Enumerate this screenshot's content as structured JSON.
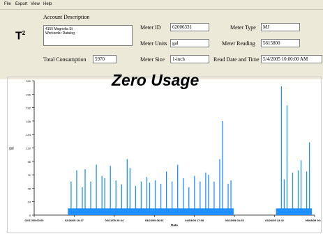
{
  "menu": [
    "File",
    "Export",
    "View",
    "Help"
  ],
  "logo": {
    "text": "T",
    "sup": "2"
  },
  "account": {
    "label": "Account Description",
    "line1": "4155 Magnolia St",
    "line2": "Workorder Datalog"
  },
  "fields": {
    "meter_id_label": "Meter ID",
    "meter_id": "62006331",
    "meter_type_label": "Meter Type",
    "meter_type": "MJ",
    "meter_units_label": "Meter Units",
    "meter_units": "gal",
    "meter_reading_label": "Meter Reading",
    "meter_reading": "5615800",
    "total_consumption_label": "Total Consumption",
    "total_consumption": "5970",
    "meter_size_label": "Meter Size",
    "meter_size": "1-inch",
    "read_date_label": "Read Date and Time",
    "read_date": "5/4/2005 10:00:00 AM"
  },
  "overlay_text": "Zero Usage",
  "chart_data": {
    "type": "bar",
    "xlabel": "Date",
    "ylabel": "gal",
    "ylim": [
      0,
      240
    ],
    "yticks": [
      0,
      24,
      48,
      72,
      96,
      120,
      144,
      168,
      192,
      216,
      240
    ],
    "xlim": [
      "02/17/05 00:00",
      "05/08/05 00:00"
    ],
    "xticks": [
      "02/17/05 00:00",
      "02/26/05 10:17",
      "03/11/05 20:34",
      "03/23/05 06:51",
      "04/03/05 17:08",
      "04/15/05 03:25",
      "04/26/05 13:42",
      "05/08/05 00:00"
    ],
    "bar_color": "#1e90ff",
    "baseline_band_gal": 12,
    "gap_label": "Zero Usage",
    "gap_range": [
      "04/15/05 03:25",
      "04/26/05 13:42"
    ],
    "spikes_gal": [
      [
        0.13,
        60
      ],
      [
        0.15,
        80
      ],
      [
        0.17,
        50
      ],
      [
        0.18,
        82
      ],
      [
        0.2,
        60
      ],
      [
        0.22,
        90
      ],
      [
        0.24,
        70
      ],
      [
        0.25,
        66
      ],
      [
        0.27,
        88
      ],
      [
        0.29,
        62
      ],
      [
        0.31,
        55
      ],
      [
        0.33,
        100
      ],
      [
        0.34,
        84
      ],
      [
        0.36,
        52
      ],
      [
        0.38,
        60
      ],
      [
        0.4,
        68
      ],
      [
        0.41,
        58
      ],
      [
        0.43,
        62
      ],
      [
        0.45,
        56
      ],
      [
        0.47,
        78
      ],
      [
        0.49,
        60
      ],
      [
        0.51,
        90
      ],
      [
        0.53,
        66
      ],
      [
        0.55,
        50
      ],
      [
        0.57,
        70
      ],
      [
        0.59,
        60
      ],
      [
        0.61,
        76
      ],
      [
        0.62,
        72
      ],
      [
        0.64,
        60
      ],
      [
        0.66,
        100
      ],
      [
        0.67,
        168
      ],
      [
        0.69,
        56
      ],
      [
        0.7,
        62
      ],
      [
        0.88,
        230
      ],
      [
        0.89,
        64
      ],
      [
        0.9,
        196
      ],
      [
        0.92,
        76
      ],
      [
        0.94,
        80
      ],
      [
        0.95,
        98
      ],
      [
        0.97,
        78
      ],
      [
        0.98,
        130
      ]
    ]
  }
}
